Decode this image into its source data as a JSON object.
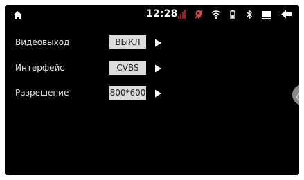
{
  "status_bar": {
    "time": "12:28",
    "icons": [
      "home-icon",
      "signal-icon",
      "no-location-icon",
      "wifi-icon",
      "battery-icon",
      "bluetooth-icon",
      "screen-icon",
      "back-icon"
    ],
    "signal_color": "#b01818",
    "no_location_color": "#d84a4a"
  },
  "settings": [
    {
      "label": "Видеовыход",
      "value": "ВЫКЛ"
    },
    {
      "label": "Интерфейс",
      "value": "CVBS"
    },
    {
      "label": "Разрешение",
      "value": "800*600"
    }
  ],
  "side_handle": {
    "icon": "chevron-left-icon"
  }
}
